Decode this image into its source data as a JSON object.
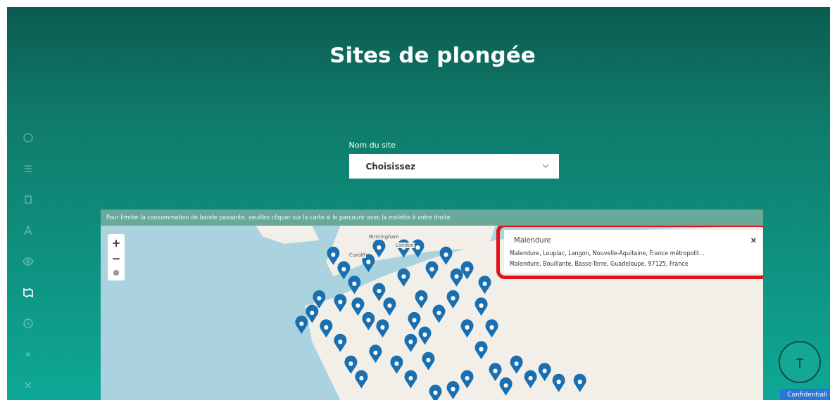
{
  "page": {
    "title": "Sites de plongée"
  },
  "sidebar": {
    "items": [
      {
        "selected": false
      },
      {
        "selected": false
      },
      {
        "selected": false
      },
      {
        "selected": false
      },
      {
        "selected": false
      },
      {
        "selected": true
      },
      {
        "selected": false
      },
      {
        "selected": false
      },
      {
        "selected": false
      }
    ]
  },
  "site_filter": {
    "label": "Nom du site",
    "value": "Choisissez"
  },
  "map": {
    "notice": "Pour limiter la consommation de bande passante, veuillez cliquer sur la carte si le parcourir avec la molette à votre droite",
    "zoom_in": "+",
    "zoom_out": "−",
    "labels": [
      "Birmingham",
      "Cardiff",
      "London"
    ],
    "search": {
      "value": "Malendure",
      "clear": "×",
      "results": [
        "Malendure, Loupiac, Langon, Nouvelle-Aquitaine, France métropolit...",
        "Malendure, Bouillante, Basse-Terre, Guadeloupe, 97125, France"
      ]
    }
  },
  "privacy_badge": "Confidentiali"
}
